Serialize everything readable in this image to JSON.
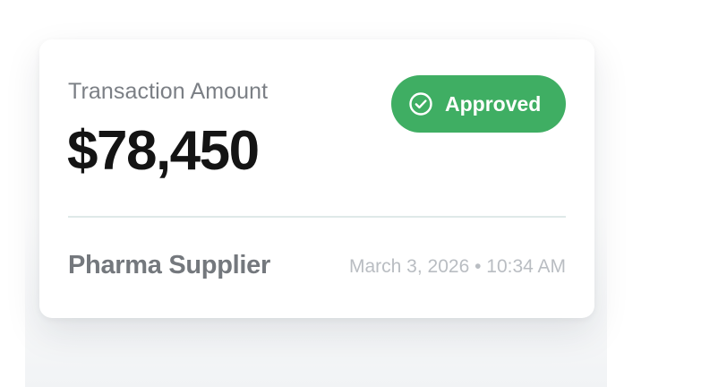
{
  "transaction": {
    "label": "Transaction Amount",
    "amount": "$78,450",
    "status": {
      "label": "Approved",
      "icon": "check-circle-icon",
      "color": "#3fae63"
    },
    "merchant": "Pharma Supplier",
    "timestamp": "March 3, 2026 • 10:34 AM"
  }
}
